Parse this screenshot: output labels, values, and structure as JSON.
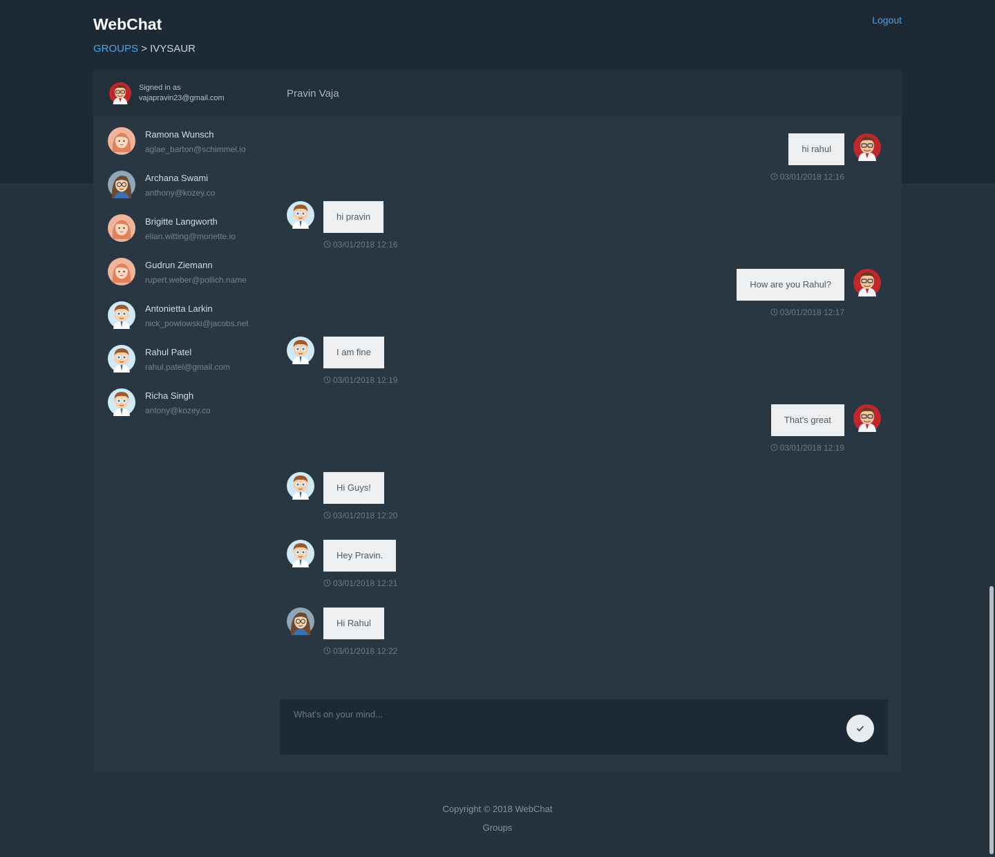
{
  "header": {
    "app_title": "WebChat",
    "logout_label": "Logout",
    "breadcrumb": {
      "link": "GROUPS",
      "separator": ">",
      "current": "IVYSAUR"
    }
  },
  "sidebar": {
    "signed_in_label": "Signed in as",
    "signed_in_email": "vajapravin23@gmail.com",
    "contacts": [
      {
        "name": "Ramona Wunsch",
        "email": "aglae_barton@schimmel.io",
        "avatar": "woman-avatar-icon"
      },
      {
        "name": "Archana Swami",
        "email": "anthony@kozey.co",
        "avatar": "woman-glasses-avatar-icon"
      },
      {
        "name": "Brigitte Langworth",
        "email": "elian.witting@moriette.io",
        "avatar": "woman-avatar-icon"
      },
      {
        "name": "Gudrun Ziemann",
        "email": "rupert.weber@pollich.name",
        "avatar": "woman-avatar-icon"
      },
      {
        "name": "Antonietta Larkin",
        "email": "nick_powlowski@jacobs.net",
        "avatar": "boy-avatar-icon"
      },
      {
        "name": "Rahul Patel",
        "email": "rahul.patel@gmail.com",
        "avatar": "boy-avatar-icon"
      },
      {
        "name": "Richa Singh",
        "email": "antony@kozey.co",
        "avatar": "boy-avatar-icon"
      }
    ]
  },
  "chat": {
    "title": "Pravin Vaja",
    "messages": [
      {
        "direction": "out",
        "text": "hi rahul",
        "time": "03/01/2018 12:16",
        "avatar": "man-glasses-avatar-icon"
      },
      {
        "direction": "in",
        "text": "hi pravin",
        "time": "03/01/2018 12:16",
        "avatar": "boy-avatar-icon"
      },
      {
        "direction": "out",
        "text": "How are you Rahul?",
        "time": "03/01/2018 12:17",
        "avatar": "man-glasses-avatar-icon"
      },
      {
        "direction": "in",
        "text": "I am fine",
        "time": "03/01/2018 12:19",
        "avatar": "boy-avatar-icon"
      },
      {
        "direction": "out",
        "text": "That's great",
        "time": "03/01/2018 12:19",
        "avatar": "man-glasses-avatar-icon"
      },
      {
        "direction": "in",
        "text": "Hi Guys!",
        "time": "03/01/2018 12:20",
        "avatar": "boy-avatar-icon"
      },
      {
        "direction": "in",
        "text": "Hey Pravin.",
        "time": "03/01/2018 12:21",
        "avatar": "boy-avatar-icon"
      },
      {
        "direction": "in",
        "text": "Hi Rahul",
        "time": "03/01/2018 12:22",
        "avatar": "woman-glasses-avatar-icon"
      }
    ],
    "composer": {
      "placeholder": "What's on your mind...",
      "value": ""
    }
  },
  "footer": {
    "copyright": "Copyright © 2018 WebChat",
    "groups_label": "Groups"
  },
  "colors": {
    "page_bg": "#26333f",
    "header_bg": "#1d2934",
    "panel_bg": "#293743",
    "accent_link": "#4da3e6",
    "bubble_bg": "#edeff1"
  }
}
